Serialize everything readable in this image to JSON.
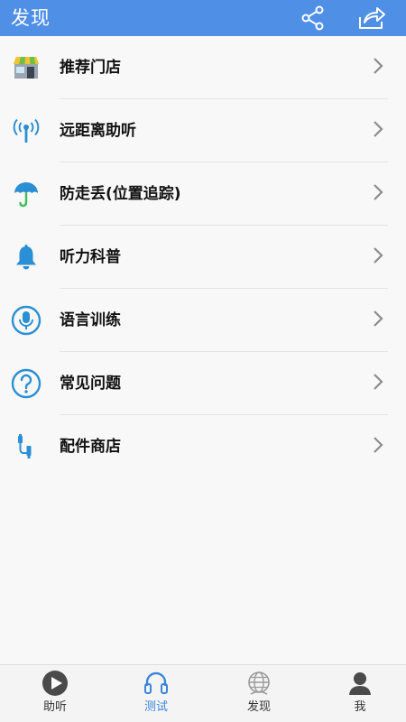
{
  "header": {
    "title": "发现",
    "share_icon": "share-icon",
    "forward_icon": "forward-icon",
    "color": "#4f8fe6"
  },
  "menu": [
    {
      "label": "推荐门店",
      "icon": "storefront-icon"
    },
    {
      "label": "远距离助听",
      "icon": "antenna-icon"
    },
    {
      "label": "防走丢(位置追踪)",
      "icon": "umbrella-icon"
    },
    {
      "label": "听力科普",
      "icon": "bell-icon"
    },
    {
      "label": "语言训练",
      "icon": "microphone-icon"
    },
    {
      "label": "常见问题",
      "icon": "question-icon"
    },
    {
      "label": "配件商店",
      "icon": "cable-icon"
    }
  ],
  "bottom_nav": [
    {
      "label": "助听",
      "icon": "play-icon",
      "active": false
    },
    {
      "label": "测试",
      "icon": "headphones-icon",
      "active": true
    },
    {
      "label": "发现",
      "icon": "globe-icon",
      "active": false
    },
    {
      "label": "我",
      "icon": "user-icon",
      "active": false
    }
  ],
  "colors": {
    "accent": "#3a86d8",
    "icon_blue": "#2a8fd4"
  }
}
